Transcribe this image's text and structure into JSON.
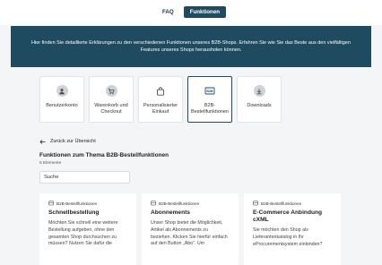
{
  "tabs": {
    "faq": "FAQ",
    "functions": "Funktionen"
  },
  "banner": {
    "text": "Hier finden Sie detaillierte Erklärungen zu den verschiedenen Funktionen unseres B2B-Shops. Erfahren Sie wie Sie das Beste aus den vielfältigen Features unseres Shops herausholen können."
  },
  "categories": [
    {
      "label": "Benutzerkonto",
      "icon": "user-icon"
    },
    {
      "label": "Warenkorb und Checkout",
      "icon": "cart-icon"
    },
    {
      "label": "Personalisierter Einkauf",
      "icon": "bag-icon"
    },
    {
      "label": "B2B-Bestellfunktionen",
      "icon": "b2b-icon",
      "selected": true
    },
    {
      "label": "Downloads",
      "icon": "download-icon"
    }
  ],
  "back_link": "Zurück zur Übersicht",
  "section": {
    "title": "Funktionen zum Thema B2B-Bestellfunktionen",
    "count": "5 Elemente"
  },
  "search": {
    "placeholder": "Suche",
    "value": ""
  },
  "cards": [
    {
      "tag": "B2B-Bestellfunktionen",
      "title": "Schnellbestellung",
      "desc": "Möchten Sie schnell eine weitere Bestellung aufgeben, ohne den gesamten Shop durchsuchen zu müssen? Nutzen Sie dafür die"
    },
    {
      "tag": "B2B-Bestellfunktionen",
      "title": "Abonnements",
      "desc": "Unser Shop bietet die Möglichkeit, Artikel als Abonnements zu beziehen. Klicken Sie hierfür einfach auf den Button „Abo“. Um"
    },
    {
      "tag": "B2B-Bestellfunktionen",
      "title": "E-Commerce Anbindung cXML",
      "desc": "Sie möchten den Shop als Lieferantenkatalog in Ihr eProcurementsystem einbinden?"
    }
  ],
  "colors": {
    "accent": "#1e4b5f",
    "background": "#f4f5f7",
    "card": "#ffffff",
    "icon_circle": "#cfd2d6"
  }
}
